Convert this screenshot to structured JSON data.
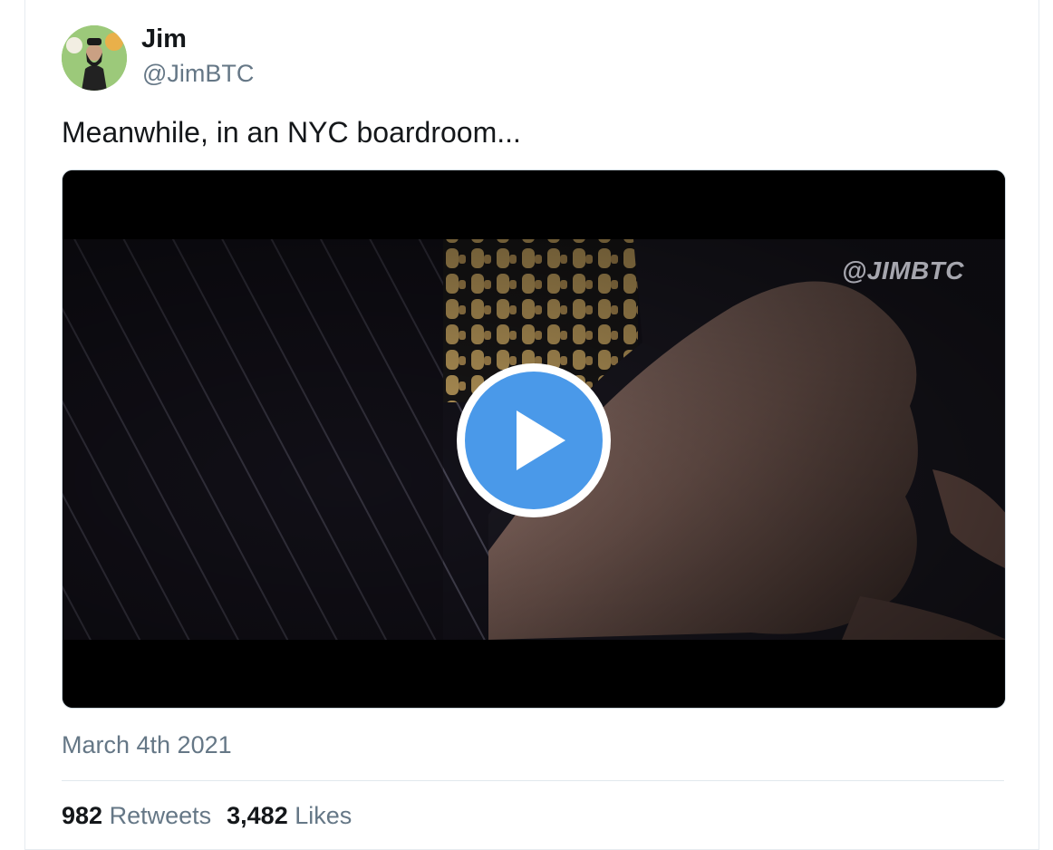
{
  "user": {
    "name": "Jim",
    "handle": "@JimBTC"
  },
  "tweet": {
    "text": "Meanwhile, in an NYC boardroom...",
    "date": "March 4th 2021"
  },
  "media": {
    "type": "video",
    "watermark": "@JIMBTC",
    "play_icon": "play-icon"
  },
  "stats": {
    "retweets_count": "982",
    "retweets_label": "Retweets",
    "likes_count": "3,482",
    "likes_label": "Likes"
  },
  "colors": {
    "accent": "#4a99e9",
    "text_primary": "#14171a",
    "text_secondary": "#657786"
  }
}
